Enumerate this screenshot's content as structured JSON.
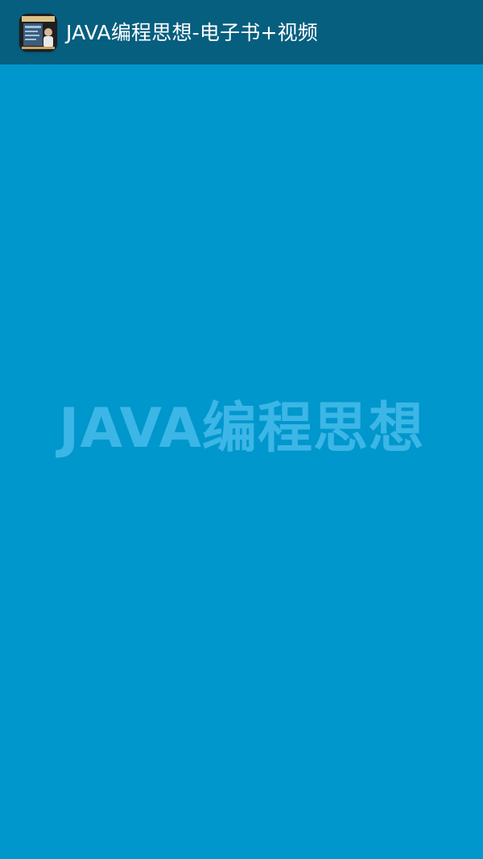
{
  "header": {
    "app_icon": "java-programming-book-cover-icon",
    "title": "JAVA编程思想-电子书+视频"
  },
  "splash": {
    "title": "JAVA编程思想"
  },
  "colors": {
    "background": "#0097cc",
    "titlebar": "#065f7f",
    "title_text": "#ffffff",
    "splash_text": "#3cb6e6"
  }
}
